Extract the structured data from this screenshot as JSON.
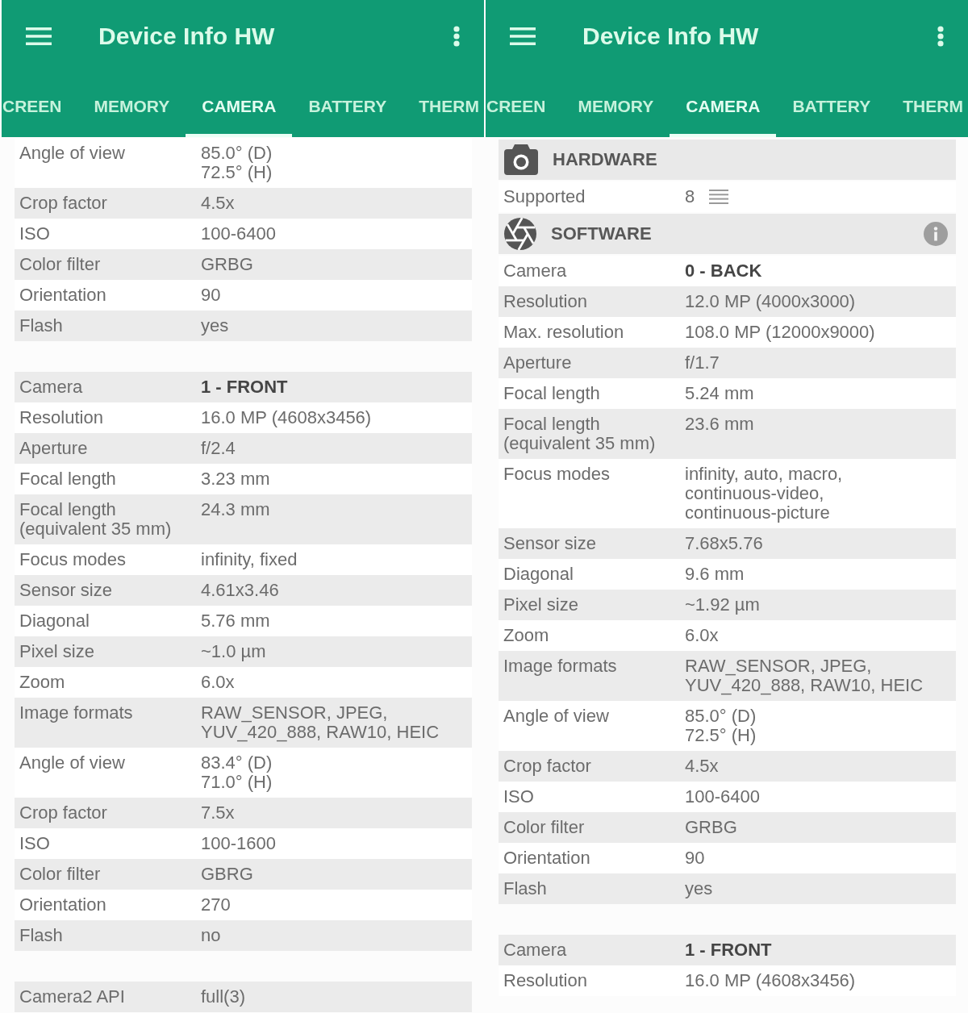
{
  "screens": [
    {
      "app_bar": {
        "title": "Device Info HW"
      },
      "tabs": [
        {
          "label": "CREEN",
          "selected": false
        },
        {
          "label": "MEMORY",
          "selected": false
        },
        {
          "label": "CAMERA",
          "selected": true
        },
        {
          "label": "BATTERY",
          "selected": false
        },
        {
          "label": "THERM",
          "selected": false
        }
      ],
      "rows": [
        {
          "kind": "field",
          "label": "Angle of view",
          "value": "85.0° (D)\n72.5° (H)",
          "shaded": false
        },
        {
          "kind": "field",
          "label": "Crop factor",
          "value": "4.5x",
          "shaded": true
        },
        {
          "kind": "field",
          "label": "ISO",
          "value": "100-6400",
          "shaded": false
        },
        {
          "kind": "field",
          "label": "Color filter",
          "value": "GRBG",
          "shaded": true
        },
        {
          "kind": "field",
          "label": "Orientation",
          "value": "90",
          "shaded": false
        },
        {
          "kind": "field",
          "label": "Flash",
          "value": "yes",
          "shaded": true
        },
        {
          "kind": "spacer"
        },
        {
          "kind": "camera_id",
          "label": "Camera",
          "value": "1 - FRONT",
          "shaded": true
        },
        {
          "kind": "field",
          "label": "Resolution",
          "value": "16.0 MP (4608x3456)",
          "shaded": false
        },
        {
          "kind": "field",
          "label": "Aperture",
          "value": "f/2.4",
          "shaded": true
        },
        {
          "kind": "field",
          "label": "Focal length",
          "value": "3.23 mm",
          "shaded": false
        },
        {
          "kind": "field",
          "label": "Focal length\n(equivalent 35 mm)",
          "value": "24.3 mm",
          "shaded": true
        },
        {
          "kind": "field",
          "label": "Focus modes",
          "value": "infinity, fixed",
          "shaded": false
        },
        {
          "kind": "field",
          "label": "Sensor size",
          "value": "4.61x3.46",
          "shaded": true
        },
        {
          "kind": "field",
          "label": "Diagonal",
          "value": "5.76 mm",
          "shaded": false
        },
        {
          "kind": "field",
          "label": "Pixel size",
          "value": "~1.0 µm",
          "shaded": true
        },
        {
          "kind": "field",
          "label": "Zoom",
          "value": "6.0x",
          "shaded": false
        },
        {
          "kind": "field",
          "label": "Image formats",
          "value": "RAW_SENSOR, JPEG,\nYUV_420_888, RAW10, HEIC",
          "shaded": true
        },
        {
          "kind": "field",
          "label": "Angle of view",
          "value": "83.4° (D)\n71.0° (H)",
          "shaded": false
        },
        {
          "kind": "field",
          "label": "Crop factor",
          "value": "7.5x",
          "shaded": true
        },
        {
          "kind": "field",
          "label": "ISO",
          "value": "100-1600",
          "shaded": false
        },
        {
          "kind": "field",
          "label": "Color filter",
          "value": "GBRG",
          "shaded": true
        },
        {
          "kind": "field",
          "label": "Orientation",
          "value": "270",
          "shaded": false
        },
        {
          "kind": "field",
          "label": "Flash",
          "value": "no",
          "shaded": true
        },
        {
          "kind": "spacer"
        },
        {
          "kind": "field",
          "label": "Camera2 API",
          "value": "full(3)",
          "shaded": true
        }
      ]
    },
    {
      "app_bar": {
        "title": "Device Info HW"
      },
      "tabs": [
        {
          "label": "CREEN",
          "selected": false
        },
        {
          "label": "MEMORY",
          "selected": false
        },
        {
          "label": "CAMERA",
          "selected": true
        },
        {
          "label": "BATTERY",
          "selected": false
        },
        {
          "label": "THERM",
          "selected": false
        }
      ],
      "rows": [
        {
          "kind": "hardware_section",
          "title": "HARDWARE",
          "info_button": false
        },
        {
          "kind": "list_field",
          "label": "Supported",
          "value": "8",
          "shaded": false
        },
        {
          "kind": "software_section",
          "title": "SOFTWARE",
          "info_button": true
        },
        {
          "kind": "camera_id",
          "label": "Camera",
          "value": "0 - BACK",
          "shaded": false
        },
        {
          "kind": "field",
          "label": "Resolution",
          "value": "12.0 MP (4000x3000)",
          "shaded": true
        },
        {
          "kind": "field",
          "label": "Max. resolution",
          "value": "108.0 MP (12000x9000)",
          "shaded": false
        },
        {
          "kind": "field",
          "label": "Aperture",
          "value": "f/1.7",
          "shaded": true
        },
        {
          "kind": "field",
          "label": "Focal length",
          "value": "5.24 mm",
          "shaded": false
        },
        {
          "kind": "field",
          "label": "Focal length\n(equivalent 35 mm)",
          "value": "23.6 mm",
          "shaded": true
        },
        {
          "kind": "field",
          "label": "Focus modes",
          "value": "infinity, auto, macro,\ncontinuous-video,\ncontinuous-picture",
          "shaded": false
        },
        {
          "kind": "field",
          "label": "Sensor size",
          "value": "7.68x5.76",
          "shaded": true
        },
        {
          "kind": "field",
          "label": "Diagonal",
          "value": "9.6 mm",
          "shaded": false
        },
        {
          "kind": "field",
          "label": "Pixel size",
          "value": "~1.92 µm",
          "shaded": true
        },
        {
          "kind": "field",
          "label": "Zoom",
          "value": "6.0x",
          "shaded": false
        },
        {
          "kind": "field",
          "label": "Image formats",
          "value": "RAW_SENSOR, JPEG,\nYUV_420_888, RAW10, HEIC",
          "shaded": true
        },
        {
          "kind": "field",
          "label": "Angle of view",
          "value": "85.0° (D)\n72.5° (H)",
          "shaded": false
        },
        {
          "kind": "field",
          "label": "Crop factor",
          "value": "4.5x",
          "shaded": true
        },
        {
          "kind": "field",
          "label": "ISO",
          "value": "100-6400",
          "shaded": false
        },
        {
          "kind": "field",
          "label": "Color filter",
          "value": "GRBG",
          "shaded": true
        },
        {
          "kind": "field",
          "label": "Orientation",
          "value": "90",
          "shaded": false
        },
        {
          "kind": "field",
          "label": "Flash",
          "value": "yes",
          "shaded": true
        },
        {
          "kind": "spacer"
        },
        {
          "kind": "camera_id",
          "label": "Camera",
          "value": "1 - FRONT",
          "shaded": true
        },
        {
          "kind": "field",
          "label": "Resolution",
          "value": "16.0 MP (4608x3456)",
          "shaded": false
        }
      ]
    }
  ]
}
